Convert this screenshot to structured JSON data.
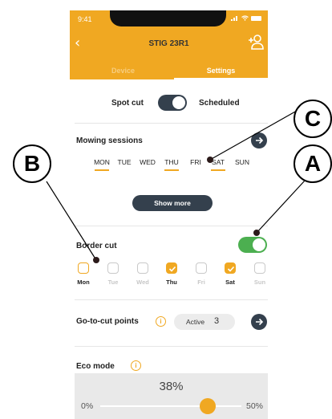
{
  "status_bar": {
    "time": "9:41"
  },
  "header": {
    "title": "STIG 23R1",
    "back_icon": "chevron-left-icon",
    "add_user_icon": "add-user-icon"
  },
  "tabs": [
    {
      "label": "Device",
      "active": false
    },
    {
      "label": "Settings",
      "active": true
    }
  ],
  "mode": {
    "left_label": "Spot cut",
    "right_label": "Scheduled",
    "toggle_on": true
  },
  "mowing_sessions": {
    "title": "Mowing sessions",
    "days": [
      {
        "label": "MON",
        "selected": true
      },
      {
        "label": "TUE",
        "selected": false
      },
      {
        "label": "WED",
        "selected": false
      },
      {
        "label": "THU",
        "selected": true
      },
      {
        "label": "FRI",
        "selected": false
      },
      {
        "label": "SAT",
        "selected": true
      },
      {
        "label": "SUN",
        "selected": false
      }
    ],
    "show_more_label": "Show more"
  },
  "border_cut": {
    "title": "Border cut",
    "enabled": true,
    "days": [
      {
        "label": "Mon",
        "state": "focused"
      },
      {
        "label": "Tue",
        "state": "off"
      },
      {
        "label": "Wed",
        "state": "off"
      },
      {
        "label": "Thu",
        "state": "checked"
      },
      {
        "label": "Fri",
        "state": "off"
      },
      {
        "label": "Sat",
        "state": "checked"
      },
      {
        "label": "Sun",
        "state": "off"
      }
    ]
  },
  "go_to_cut": {
    "title": "Go-to-cut points",
    "active_label": "Active",
    "active_count": "3"
  },
  "eco_mode": {
    "title": "Eco mode",
    "value_label": "38%",
    "value_fraction": 0.38,
    "min_label": "0%",
    "max_label": "50%"
  },
  "callouts": {
    "a": "A",
    "b": "B",
    "c": "C"
  },
  "colors": {
    "accent": "#f0a822",
    "dark": "#34404d",
    "toggle_green": "#4caf50"
  }
}
